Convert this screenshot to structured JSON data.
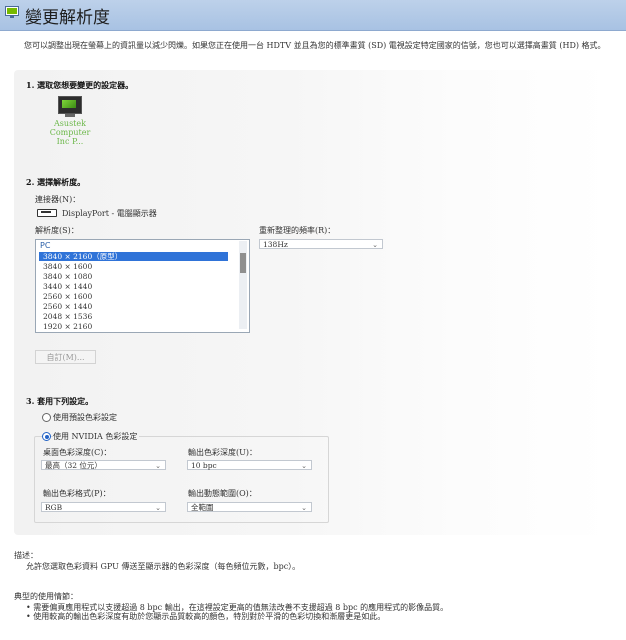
{
  "header": {
    "title": "變更解析度"
  },
  "intro": "您可以調整出現在螢幕上的資訊量以減少閃爍。如果您正在使用一台 HDTV 並且為您的標準畫質 (SD) 電視設定特定國家的信號，您也可以選擇高畫質 (HD) 格式。",
  "step1": {
    "heading": "1. 選取您想要變更的設定器。",
    "monitor_label_1": "Asustek Computer",
    "monitor_label_2": "Inc P..."
  },
  "step2": {
    "heading": "2. 選擇解析度。",
    "connector_label": "連接器(N)：",
    "connector_value": "DisplayPort - 電腦顯示器",
    "resolution_label": "解析度(S)：",
    "refresh_label": "重新整理的頻率(R)：",
    "refresh_value": "138Hz",
    "group": "PC",
    "resolutions": [
      "3840 × 2160（原型）",
      "3840 × 1600",
      "3840 × 1080",
      "3440 × 1440",
      "2560 × 1600",
      "2560 × 1440",
      "2048 × 1536",
      "1920 × 2160"
    ],
    "custom_button": "自訂(M)..."
  },
  "step3": {
    "heading": "3. 套用下列設定。",
    "radio_default": "使用預設色彩設定",
    "radio_nvidia": "使用 NVIDIA 色彩設定",
    "desktop_depth_label": "桌面色彩深度(C)：",
    "desktop_depth_value": "最高（32 位元）",
    "output_depth_label": "輸出色彩深度(U)：",
    "output_depth_value": "10 bpc",
    "output_format_label": "輸出色彩格式(P)：",
    "output_format_value": "RGB",
    "dynamic_range_label": "輸出動態範圍(O)：",
    "dynamic_range_value": "全範圍"
  },
  "footer": {
    "desc_heading": "描述：",
    "desc_text": "允許您選取色彩資料 GPU 傳送至顯示器的色彩深度（每色頻位元數，bpc）。",
    "usage_heading": "典型的使用情節：",
    "usage_1": "•  需要偏頁應用程式以支援超過 8 bpc 輸出，在這裡設定更高的值無法改善不支援超過 8 bpc 的應用程式的影像品質。",
    "usage_2": "•  使用較高的輸出色彩深度有助於您顯示品質較高的顏色，特別對於平滑的色彩切換和漸層更是如此。"
  }
}
